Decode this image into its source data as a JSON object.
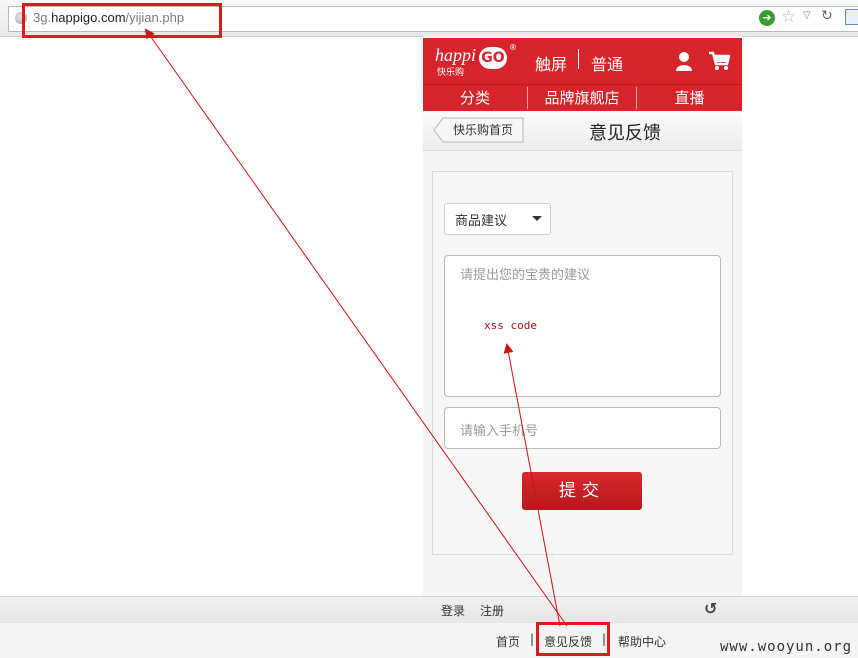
{
  "browser": {
    "url_prefix": "3g.",
    "url_domain": "happigo.com",
    "url_path": "/yijian.php"
  },
  "site": {
    "logo_text": "happi",
    "logo_go": "GO",
    "logo_sub": "快乐购",
    "logo_reg": "®",
    "mode_touch": "触屏",
    "mode_plain": "普通",
    "nav": [
      "分类",
      "品牌旗舰店",
      "直播"
    ],
    "accent_color": "#d7232a"
  },
  "subheader": {
    "back_label": "快乐购首页",
    "title": "意见反馈"
  },
  "form": {
    "category_selected": "商品建议",
    "suggestion_placeholder": "请提出您的宝贵的建议",
    "suggestion_value": "xss code",
    "phone_placeholder": "请输入手机号",
    "submit_label": "提交"
  },
  "footer": {
    "login": "登录",
    "register": "注册",
    "links": [
      "首页",
      "意见反馈",
      "帮助中心"
    ],
    "separator": "|"
  },
  "watermark": "www.wooyun.org",
  "annotation_color": "#e01a1a"
}
